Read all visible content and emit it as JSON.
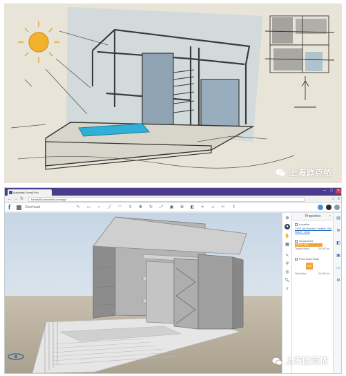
{
  "watermark": {
    "text": "上海欧克侬"
  },
  "browser": {
    "tab_title": "Autodesk FormIt Pro",
    "url": "formit360.autodesk.com/app/",
    "nav": {
      "back": "←",
      "forward": "→",
      "reload": "↻"
    }
  },
  "app": {
    "logo": "f",
    "title": "Overhead"
  },
  "properties_panel": {
    "title": "Properties",
    "close": "×",
    "location": {
      "label": "Location",
      "link_line1": "2330 NW Market, Seattle, WA",
      "link_line2": "98107, USA"
    },
    "gross_area": {
      "label": "Gross Area",
      "value": "18432 sq ft",
      "target_label": "Target Area",
      "target_value": "20,000 sf"
    },
    "floor_area_ratio": {
      "label": "Floor Area Ratio",
      "value": "0.66",
      "site_area_label": "Site Area",
      "site_area_value": "33,000 sf"
    }
  },
  "icons": {
    "toolbar": [
      "select-icon",
      "rectangle-icon",
      "circle-icon",
      "line-icon",
      "arc-icon",
      "push-pull-icon",
      "move-icon",
      "rotate-icon",
      "scale-icon",
      "group-icon",
      "layers-icon",
      "materials-icon",
      "location-icon",
      "sun-icon",
      "measure-icon",
      "share-icon"
    ],
    "view_tools": [
      "orbit-icon",
      "pan-icon",
      "zoom-icon",
      "fit-icon",
      "home-view-icon",
      "walk-icon",
      "zoom-window-icon"
    ],
    "right_tools": [
      "properties-icon",
      "layers-icon",
      "materials-icon",
      "groups-icon",
      "scenes-icon",
      "settings-icon"
    ]
  },
  "colors": {
    "sketch_paper": "#e9e4d8",
    "pool": "#2fb0d6",
    "sun": "#f0a520",
    "accent_orange": "#f2a23a",
    "app_blue": "#1f5fa8",
    "browser_purple": "#4c3a8a"
  }
}
